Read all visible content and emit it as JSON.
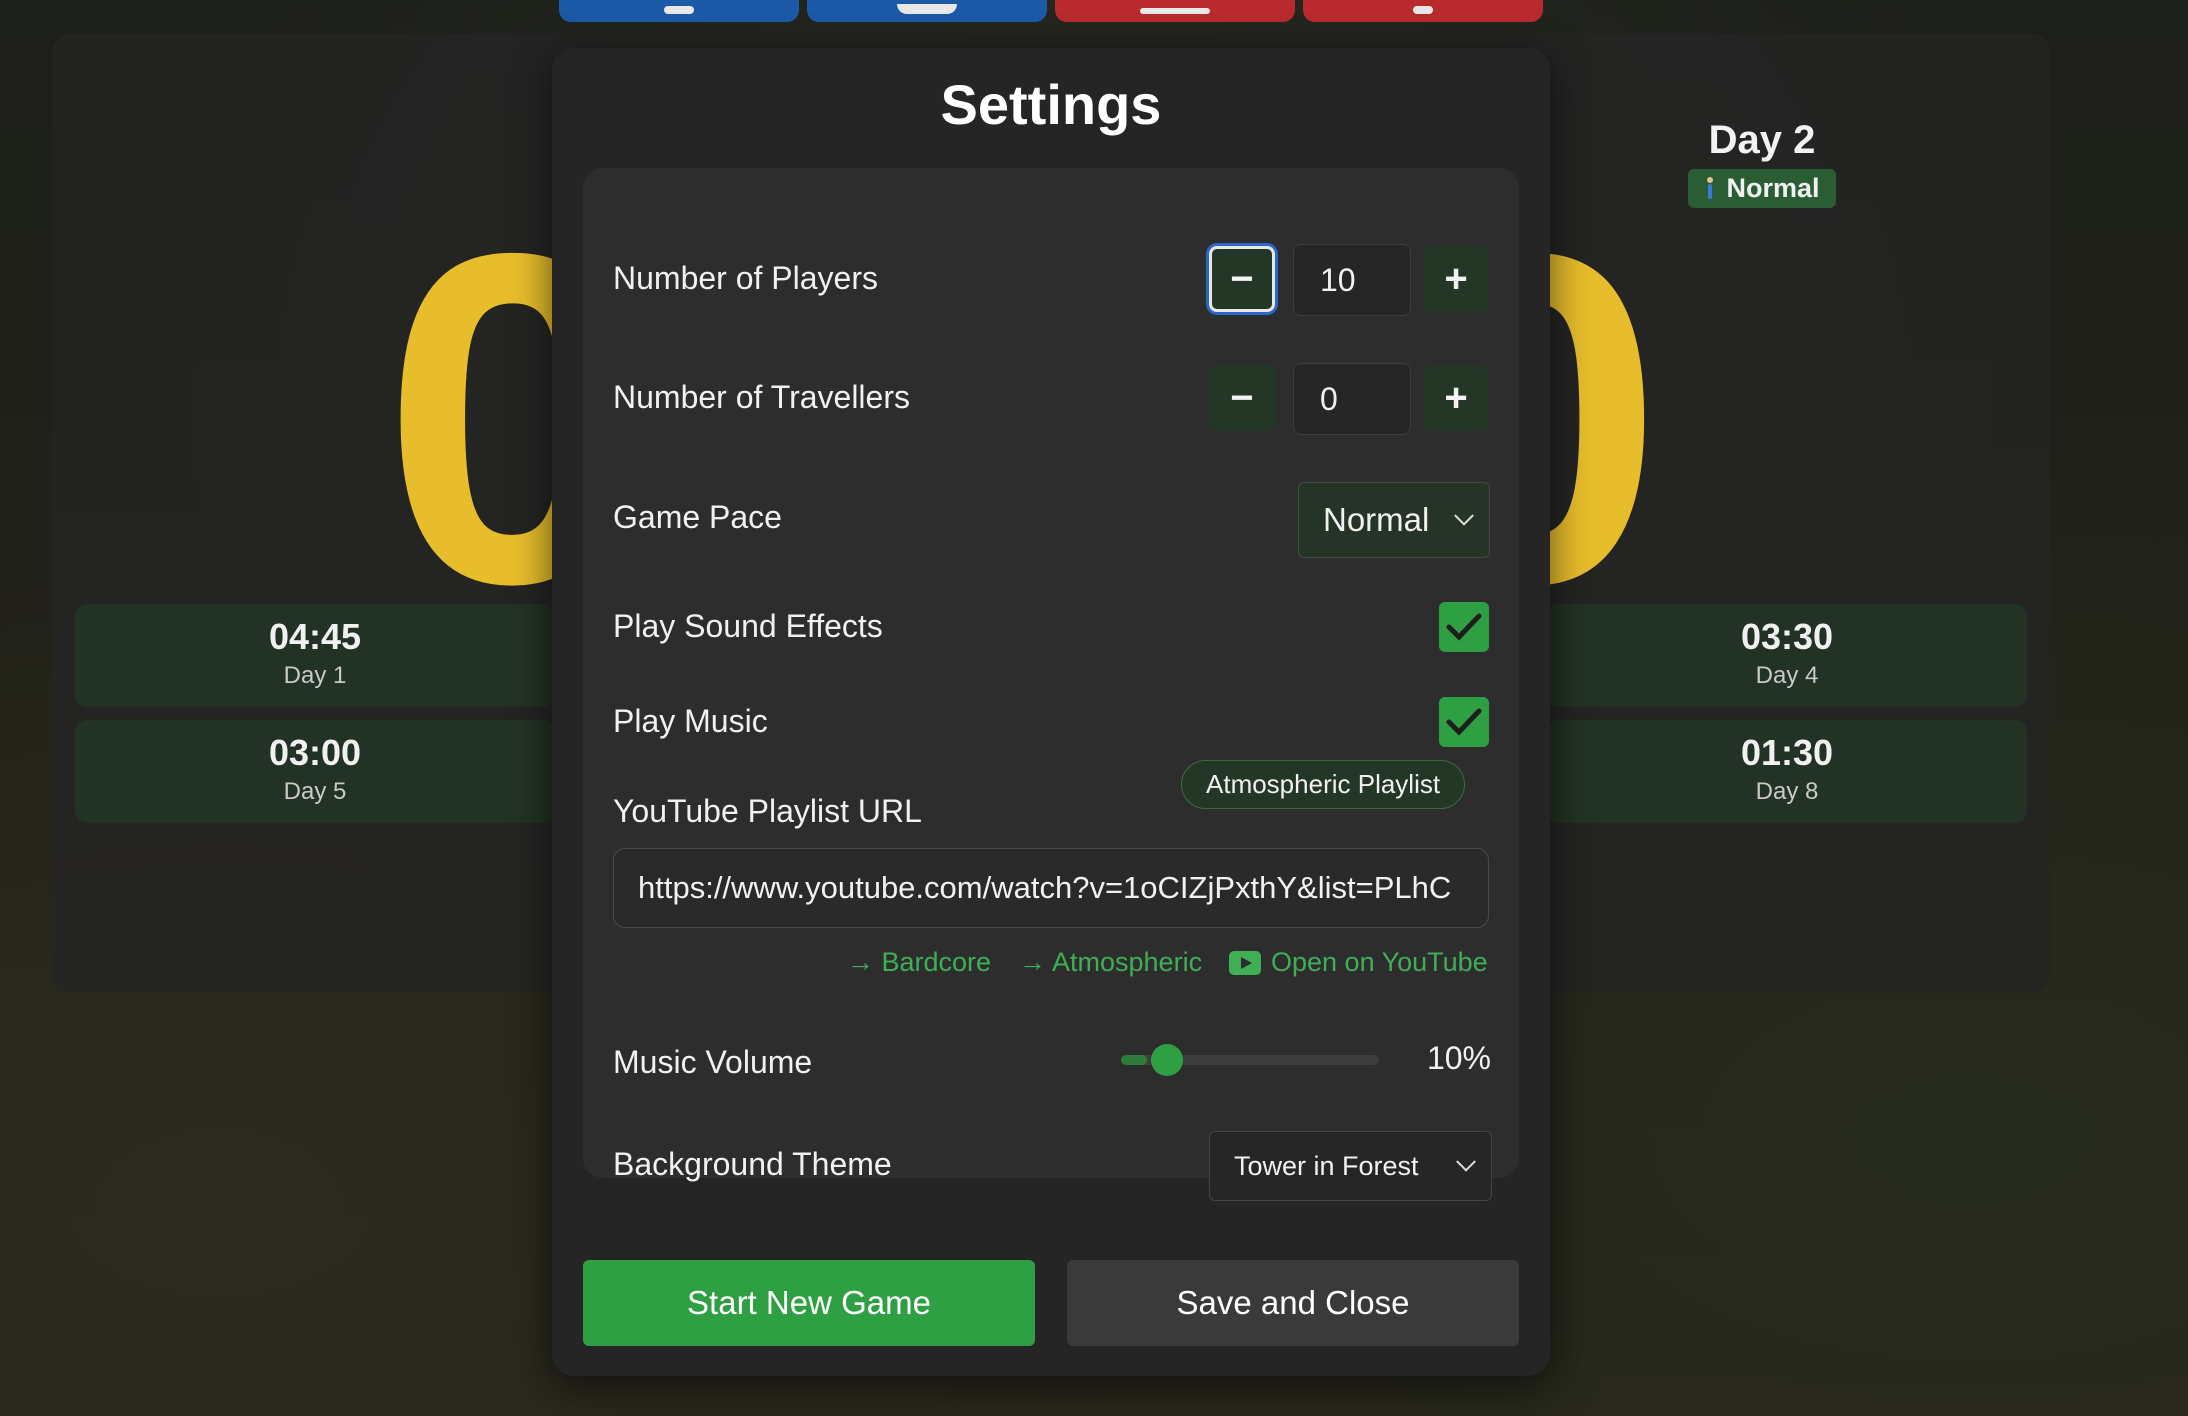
{
  "background": {
    "big_digit_left": "0",
    "big_digit_right": "0",
    "day_title": "Day 2",
    "pace_badge": "Normal",
    "time_cards": [
      {
        "time": "04:45",
        "day": "Day 1"
      },
      {
        "time": "03:00",
        "day": "Day 5"
      },
      {
        "time": "03:30",
        "day": "Day 4"
      },
      {
        "time": "01:30",
        "day": "Day 8"
      }
    ]
  },
  "settings": {
    "title": "Settings",
    "players": {
      "label": "Number of Players",
      "value": "10",
      "minus": "−",
      "plus": "+"
    },
    "travellers": {
      "label": "Number of Travellers",
      "value": "0",
      "minus": "−",
      "plus": "+"
    },
    "pace": {
      "label": "Game Pace",
      "selected": "Normal"
    },
    "sound": {
      "label": "Play Sound Effects",
      "checked": true
    },
    "music": {
      "label": "Play Music",
      "checked": true
    },
    "playlist": {
      "label": "YouTube Playlist URL",
      "value": "https://www.youtube.com/watch?v=1oCIZjPxthY&list=PLhC",
      "tooltip": "Atmospheric Playlist",
      "links": {
        "bardcore": "→ Bardcore",
        "atmospheric": "→ Atmospheric",
        "youtube": "Open on YouTube"
      }
    },
    "volume": {
      "label": "Music Volume",
      "value_text": "10%",
      "fraction": 0.1
    },
    "theme": {
      "label": "Background Theme",
      "selected": "Tower in Forest"
    },
    "buttons": {
      "start": "Start New Game",
      "save": "Save and Close"
    }
  },
  "colors": {
    "accent": "#2ea043",
    "digit": "#e7bd2c",
    "tab_blue": "#1c5aa8",
    "tab_red": "#b82a2e"
  }
}
